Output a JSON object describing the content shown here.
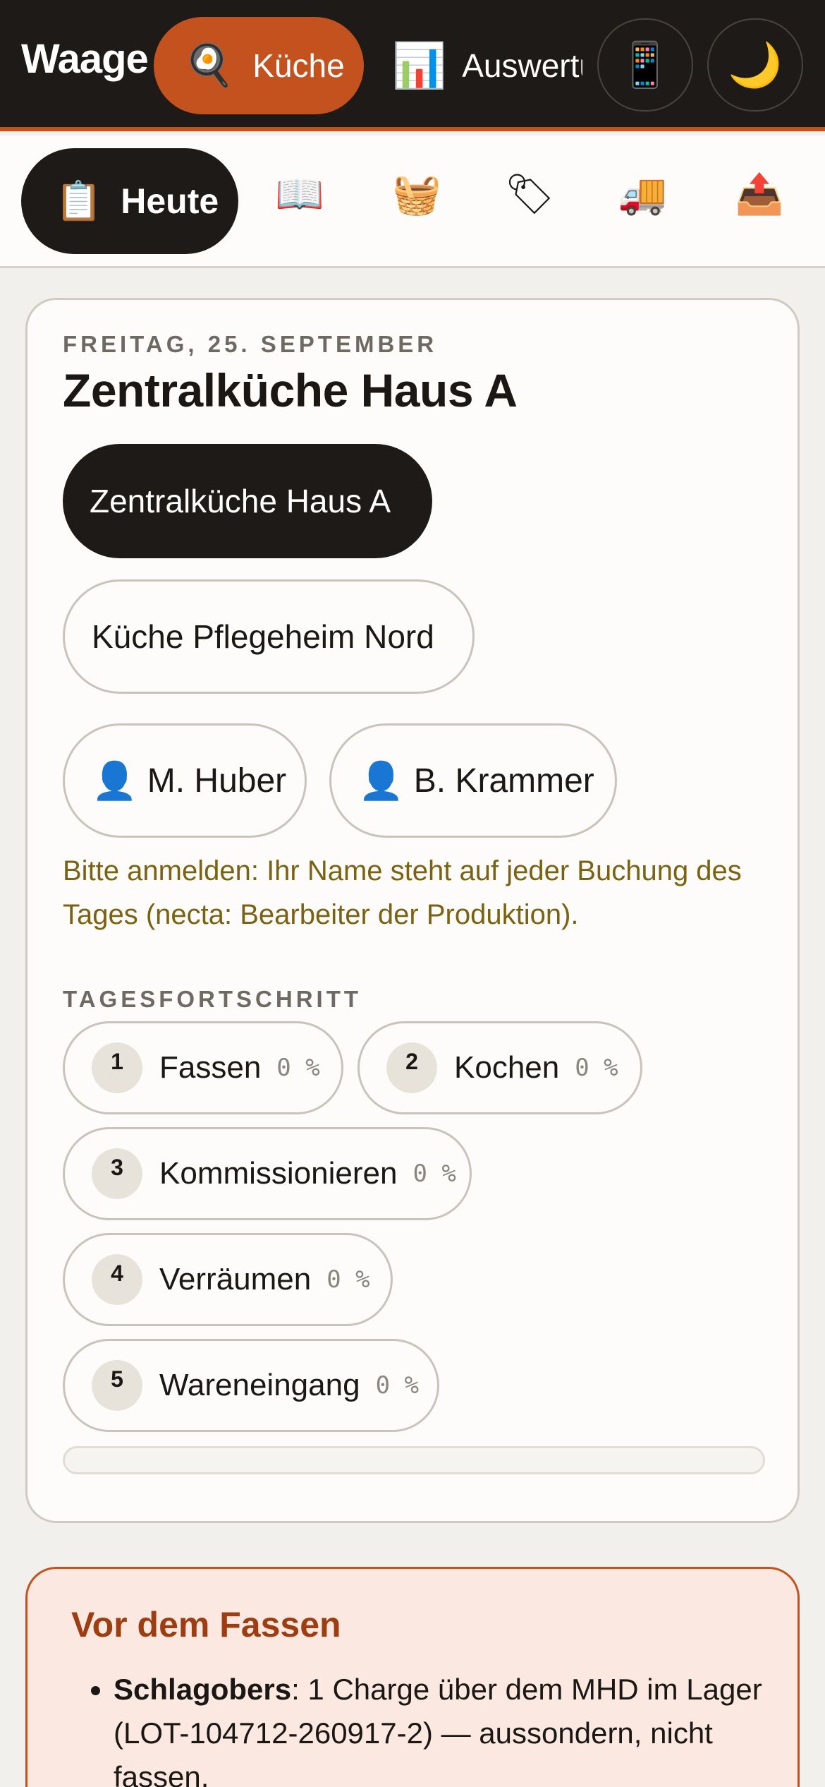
{
  "topbar": {
    "brand": "Waage",
    "tabs": [
      {
        "icon": "frying-pan-icon",
        "glyph": "🍳",
        "label": "Küche"
      },
      {
        "icon": "bar-chart-icon",
        "glyph": "📊",
        "label": "Auswertu"
      }
    ],
    "buttons": [
      {
        "icon": "mobile-phone-icon",
        "glyph": "📱"
      },
      {
        "icon": "moon-icon",
        "glyph": "🌙"
      }
    ],
    "accent_color": "#c4521e"
  },
  "subnav": {
    "active": {
      "icon": "clipboard-icon",
      "glyph": "📋",
      "label": "Heute"
    },
    "items": [
      {
        "icon": "book-icon",
        "glyph": "📖"
      },
      {
        "icon": "basket-icon",
        "glyph": "🧺"
      },
      {
        "icon": "tag-icon",
        "glyph": "🏷"
      },
      {
        "icon": "delivery-truck-icon",
        "glyph": "🚚"
      },
      {
        "icon": "outbox-tray-icon",
        "glyph": "📤"
      }
    ]
  },
  "main": {
    "date": "FREITAG, 25. SEPTEMBER",
    "title": "Zentralküche Haus A",
    "kitchens": [
      {
        "label": "Zentralküche Haus A",
        "selected": true
      },
      {
        "label": "Küche Pflegeheim Nord",
        "selected": false
      }
    ],
    "users": [
      {
        "glyph": "👤",
        "name": "M. Huber"
      },
      {
        "glyph": "👤",
        "name": "B. Krammer"
      }
    ],
    "hint": "Bitte anmelden: Ihr Name steht auf jeder Buchung des Tages (necta: Bearbeiter der Produktion).",
    "progress_label": "TAGESFORTSCHRITT",
    "steps": [
      {
        "num": "1",
        "label": "Fassen",
        "pct": "0 %"
      },
      {
        "num": "2",
        "label": "Kochen",
        "pct": "0 %"
      },
      {
        "num": "3",
        "label": "Kommissionieren",
        "pct": "0 %"
      },
      {
        "num": "4",
        "label": "Verräumen",
        "pct": "0 %"
      },
      {
        "num": "5",
        "label": "Wareneingang",
        "pct": "0 %"
      }
    ],
    "overall_progress": 0
  },
  "warning": {
    "title": "Vor dem Fassen",
    "items": [
      {
        "bold": "Schlagobers",
        "text": ": 1 Charge über dem MHD im Lager (LOT-104712-260917-2) — aussondern, nicht fassen."
      }
    ]
  }
}
